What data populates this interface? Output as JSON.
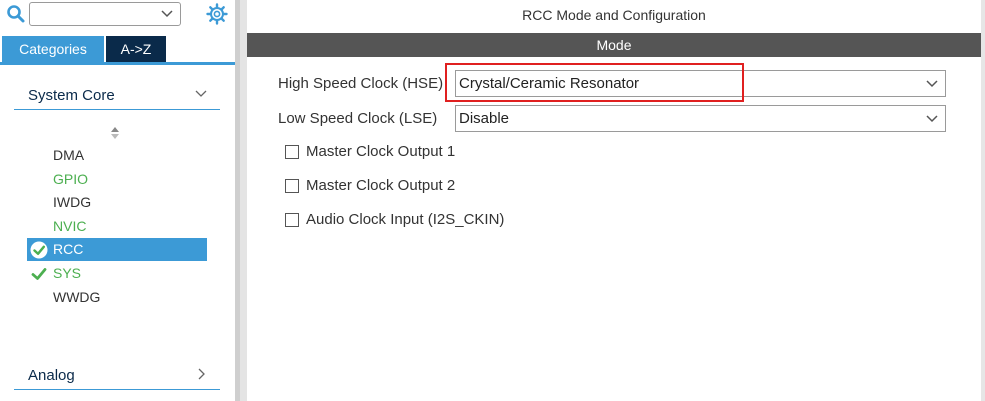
{
  "sidebar": {
    "search": {
      "value": ""
    },
    "tabs": [
      {
        "label": "Categories",
        "active": true
      },
      {
        "label": "A->Z",
        "active": false
      }
    ],
    "groups": [
      {
        "label": "System Core",
        "expanded": true,
        "items": [
          {
            "label": "DMA",
            "status": "none",
            "color": "#333333"
          },
          {
            "label": "GPIO",
            "status": "none",
            "color": "#4caf50"
          },
          {
            "label": "IWDG",
            "status": "none",
            "color": "#333333"
          },
          {
            "label": "NVIC",
            "status": "none",
            "color": "#4caf50"
          },
          {
            "label": "RCC",
            "status": "check-circle",
            "selected": true
          },
          {
            "label": "SYS",
            "status": "check",
            "color": "#4caf50"
          },
          {
            "label": "WWDG",
            "status": "none",
            "color": "#333333"
          }
        ]
      },
      {
        "label": "Analog",
        "expanded": false
      }
    ]
  },
  "main": {
    "title": "RCC Mode and Configuration",
    "section": "Mode",
    "fields": [
      {
        "label": "High Speed Clock (HSE)",
        "value": "Crystal/Ceramic Resonator",
        "highlighted": true
      },
      {
        "label": "Low Speed Clock (LSE)",
        "value": "Disable"
      }
    ],
    "checkboxes": [
      {
        "label": "Master Clock Output 1",
        "checked": false
      },
      {
        "label": "Master Clock Output 2",
        "checked": false
      },
      {
        "label": "Audio Clock Input (I2S_CKIN)",
        "checked": false
      }
    ]
  },
  "colors": {
    "accent": "#3c9ad6",
    "tab_dark": "#0a2a4a",
    "mode_bar": "#555555",
    "highlight": "#e02020",
    "enabled_green": "#4caf50"
  }
}
